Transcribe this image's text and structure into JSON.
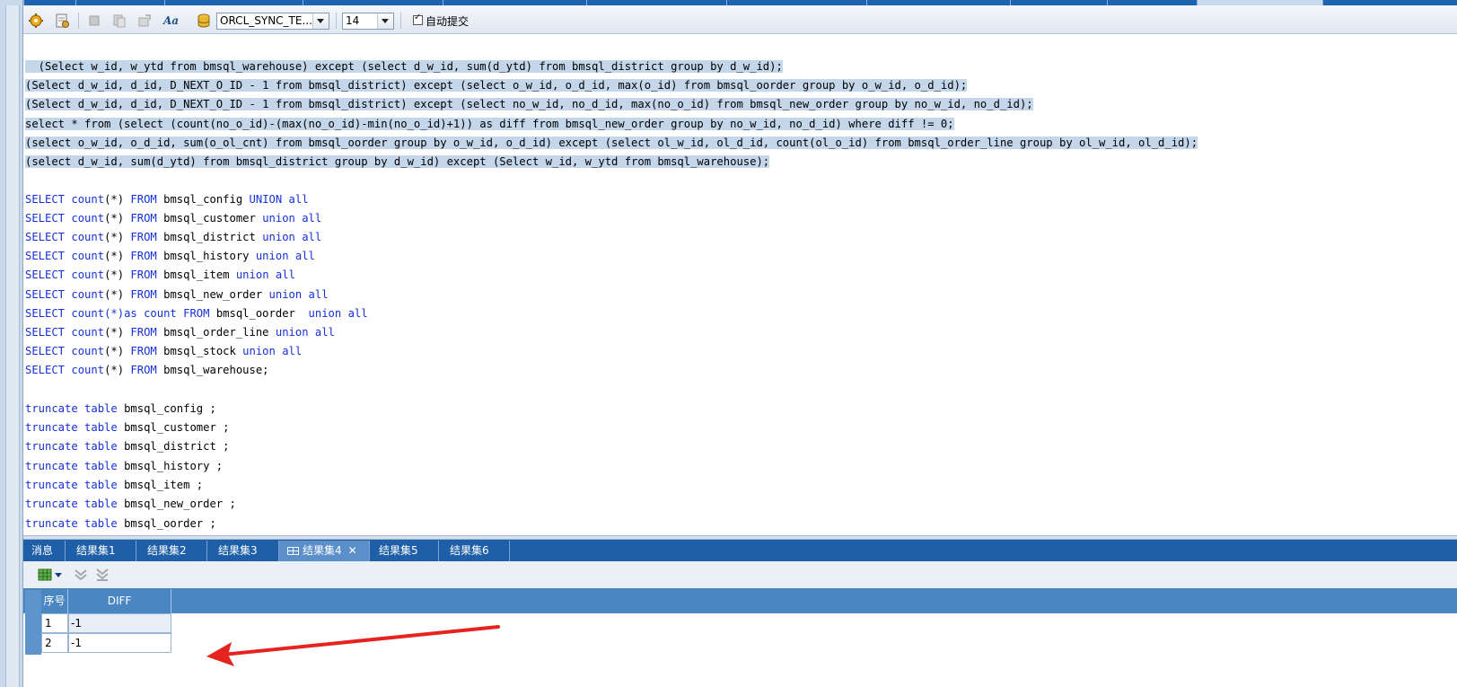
{
  "top_tabs": [
    "",
    "",
    "",
    "",
    "",
    "",
    "",
    "",
    "",
    "",
    "",
    ""
  ],
  "toolbar": {
    "connection": "ORCL_SYNC_TE...",
    "font_size": "14",
    "autocommit_label": "自动提交",
    "aa_label": "Aa"
  },
  "editor": {
    "highlighted_lines": [
      "  (Select w_id, w_ytd from bmsql_warehouse) except (select d_w_id, sum(d_ytd) from bmsql_district group by d_w_id);",
      "(Select d_w_id, d_id, D_NEXT_O_ID - 1 from bmsql_district) except (select o_w_id, o_d_id, max(o_id) from bmsql_oorder group by o_w_id, o_d_id);",
      "(Select d_w_id, d_id, D_NEXT_O_ID - 1 from bmsql_district) except (select no_w_id, no_d_id, max(no_o_id) from bmsql_new_order group by no_w_id, no_d_id);",
      "select * from (select (count(no_o_id)-(max(no_o_id)-min(no_o_id)+1)) as diff from bmsql_new_order group by no_w_id, no_d_id) where diff != 0;",
      "(select o_w_id, o_d_id, sum(o_ol_cnt) from bmsql_oorder group by o_w_id, o_d_id) except (select ol_w_id, ol_d_id, count(ol_o_id) from bmsql_order_line group by ol_w_id, ol_d_id);",
      "(select d_w_id, sum(d_ytd) from bmsql_district group by d_w_id) except (Select w_id, w_ytd from bmsql_warehouse);"
    ],
    "select_lines": [
      {
        "kw1": "SELECT",
        "fn": "count",
        "mid": "(*) ",
        "kw2": "FROM",
        "table": " bmsql_config ",
        "tail": "UNION all"
      },
      {
        "kw1": "SELECT",
        "fn": "count",
        "mid": "(*) ",
        "kw2": "FROM",
        "table": " bmsql_customer ",
        "tail": "union all"
      },
      {
        "kw1": "SELECT",
        "fn": "count",
        "mid": "(*) ",
        "kw2": "FROM",
        "table": " bmsql_district ",
        "tail": "union all"
      },
      {
        "kw1": "SELECT",
        "fn": "count",
        "mid": "(*) ",
        "kw2": "FROM",
        "table": " bmsql_history ",
        "tail": "union all"
      },
      {
        "kw1": "SELECT",
        "fn": "count",
        "mid": "(*) ",
        "kw2": "FROM",
        "table": " bmsql_item ",
        "tail": "union all"
      },
      {
        "kw1": "SELECT",
        "fn": "count",
        "mid": "(*) ",
        "kw2": "FROM",
        "table": " bmsql_new_order ",
        "tail": "union all"
      },
      {
        "kw1": "SELECT",
        "fn": "count",
        "mid": "(*)as count ",
        "kw2": "FROM",
        "table": " bmsql_oorder  ",
        "tail": "union all"
      },
      {
        "kw1": "SELECT",
        "fn": "count",
        "mid": "(*) ",
        "kw2": "FROM",
        "table": " bmsql_order_line ",
        "tail": "union all"
      },
      {
        "kw1": "SELECT",
        "fn": "count",
        "mid": "(*) ",
        "kw2": "FROM",
        "table": " bmsql_stock ",
        "tail": "union all"
      },
      {
        "kw1": "SELECT",
        "fn": "count",
        "mid": "(*) ",
        "kw2": "FROM",
        "table": " bmsql_warehouse;",
        "tail": ""
      }
    ],
    "truncate_lines": [
      {
        "kw": "truncate table",
        "rest": " bmsql_config ;"
      },
      {
        "kw": "truncate table",
        "rest": " bmsql_customer ;"
      },
      {
        "kw": "truncate table",
        "rest": " bmsql_district ;"
      },
      {
        "kw": "truncate table",
        "rest": " bmsql_history ;"
      },
      {
        "kw": "truncate table",
        "rest": " bmsql_item ;"
      },
      {
        "kw": "truncate table",
        "rest": " bmsql_new_order ;"
      },
      {
        "kw": "truncate table",
        "rest": " bmsql_oorder ;"
      }
    ]
  },
  "result_tabs": [
    "消息",
    "结果集1",
    "结果集2",
    "结果集3",
    "结果集4",
    "结果集5",
    "结果集6"
  ],
  "active_result_tab": "结果集4",
  "result_grid": {
    "columns": [
      "序号",
      "DIFF"
    ],
    "rows": [
      {
        "no": "1",
        "diff": "-1"
      },
      {
        "no": "2",
        "diff": "-1"
      }
    ]
  },
  "colors": {
    "keyword": "#1530d8",
    "selection": "#c3d6ea",
    "tab_bar": "#1f5fa8",
    "grid_header": "#4a86c2",
    "annotation_arrow": "#e52420"
  }
}
